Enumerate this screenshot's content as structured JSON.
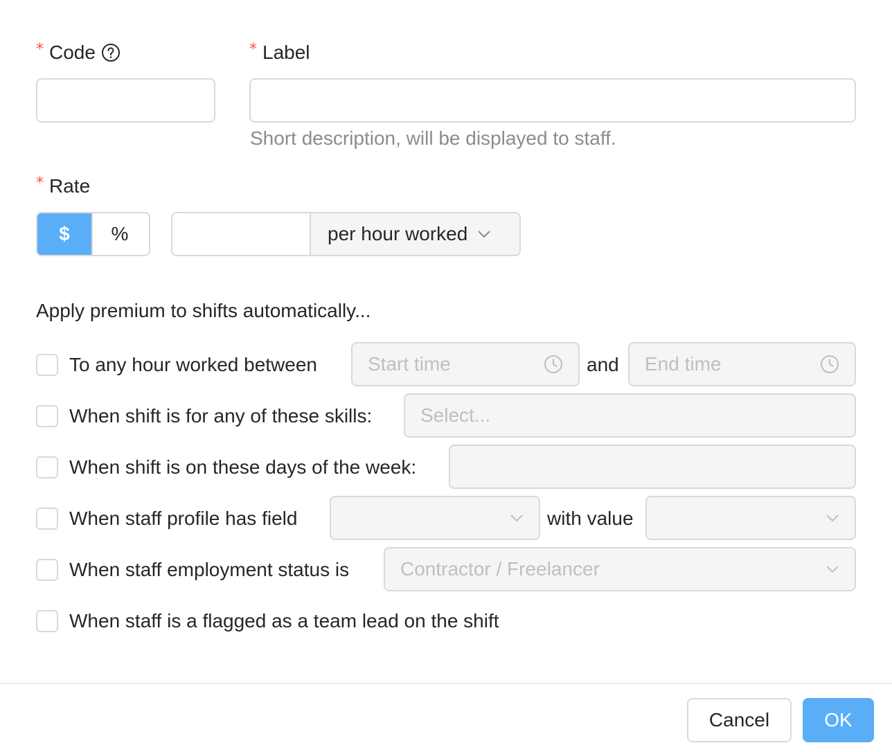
{
  "code": {
    "label": "Code",
    "value": ""
  },
  "label_field": {
    "label": "Label",
    "value": "",
    "hint": "Short description, will be displayed to staff."
  },
  "rate": {
    "label": "Rate",
    "type_options": [
      "$",
      "%"
    ],
    "selected_type": "$",
    "value": "",
    "unit": "per hour worked"
  },
  "apply": {
    "title": "Apply premium to shifts automatically...",
    "hours": {
      "label": "To any hour worked between",
      "start_placeholder": "Start time",
      "connector": "and",
      "end_placeholder": "End time",
      "checked": false
    },
    "skills": {
      "label": "When shift is for any of these skills:",
      "placeholder": "Select...",
      "checked": false
    },
    "days": {
      "label": "When shift is on these days of the week:",
      "value": "",
      "checked": false
    },
    "profile": {
      "label": "When staff profile has field",
      "field_value": "",
      "connector": "with value",
      "value": "",
      "checked": false
    },
    "employment": {
      "label": "When staff employment status is",
      "value": "Contractor / Freelancer",
      "checked": false
    },
    "team_lead": {
      "label": "When staff is a flagged as a team lead on the shift",
      "checked": false
    }
  },
  "footer": {
    "cancel_label": "Cancel",
    "ok_label": "OK"
  },
  "colors": {
    "primary": "#5aaef7",
    "required": "#ff4d4f",
    "border": "#d9d9d9",
    "disabled_bg": "#f5f5f5"
  },
  "icons": {
    "help": "question-circle-icon",
    "clock": "clock-icon",
    "chevron": "chevron-down-icon"
  }
}
